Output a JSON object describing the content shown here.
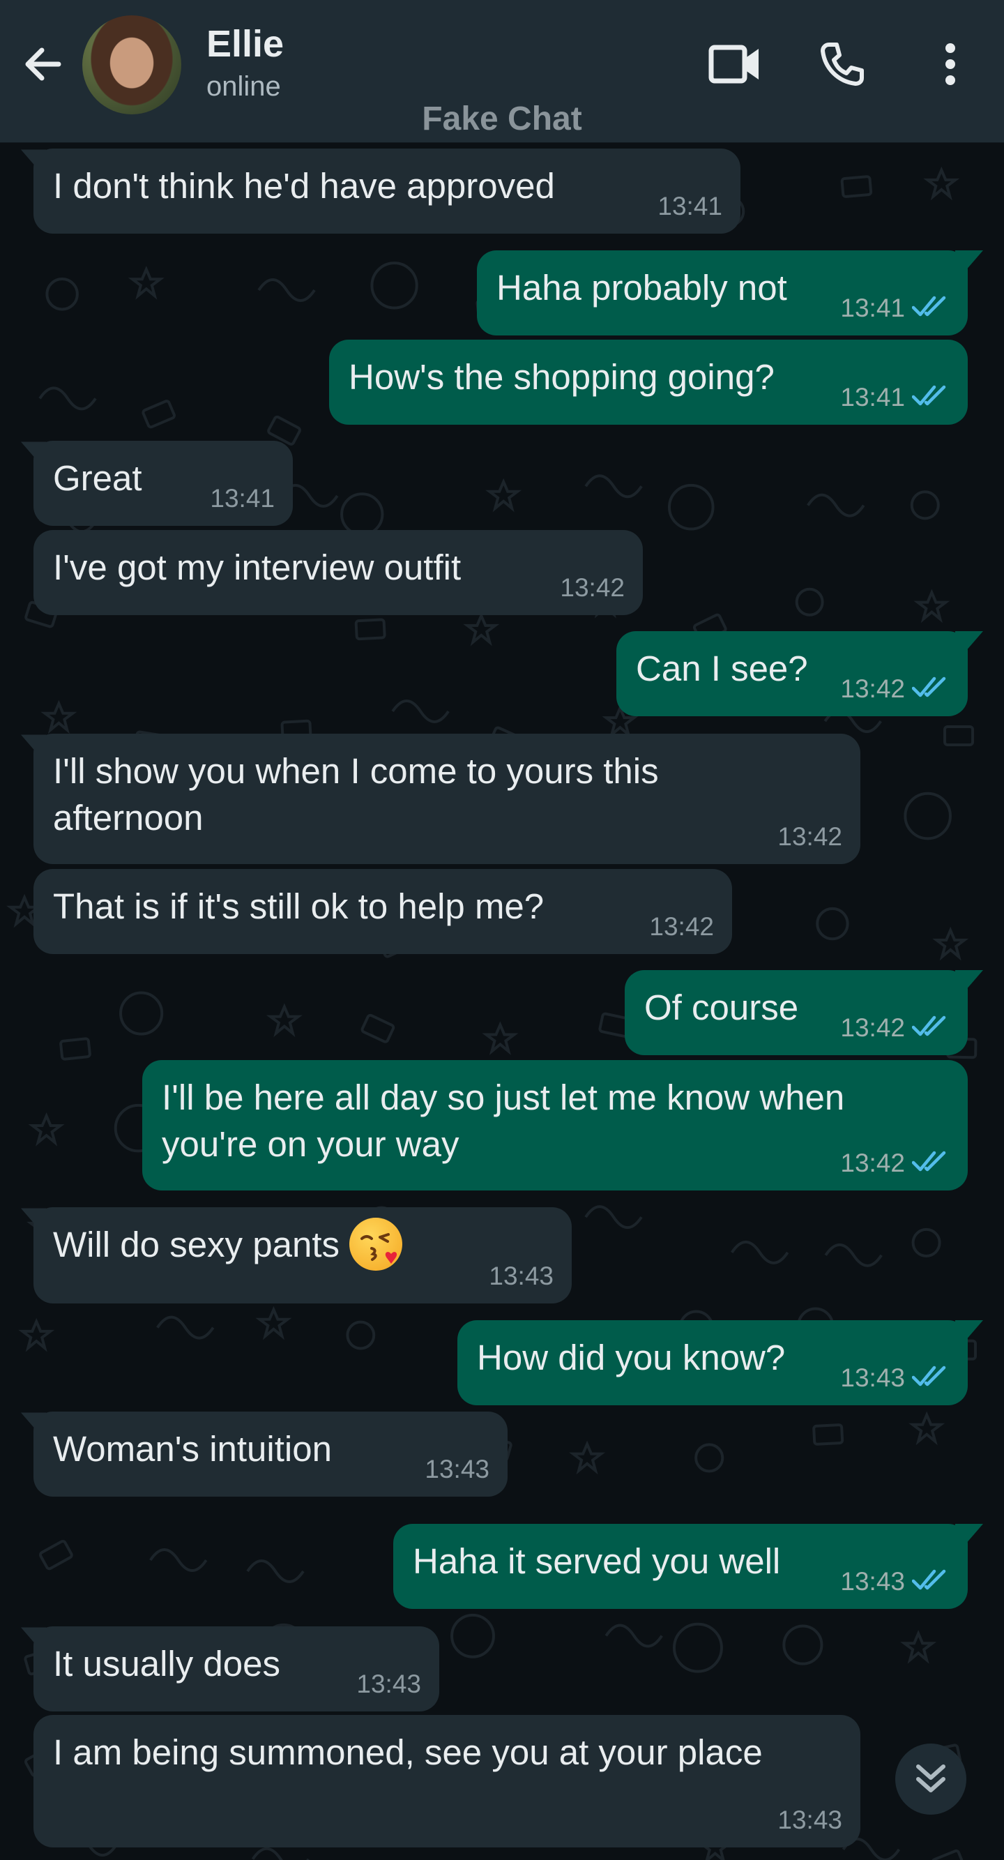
{
  "header": {
    "back_icon": "arrow-left-icon",
    "contact_name": "Ellie",
    "status": "online",
    "video_icon": "video-camera-icon",
    "call_icon": "phone-icon",
    "menu_icon": "more-vertical-icon"
  },
  "watermark": "Fake Chat",
  "colors": {
    "header_bg": "#1f2c34",
    "chat_bg": "#0b1014",
    "incoming_bubble": "#202c33",
    "outgoing_bubble": "#005c4b",
    "read_ticks": "#53bdeb"
  },
  "messages": [
    {
      "dir": "in",
      "text": "I don't think he'd have approved",
      "time": "13:41"
    },
    {
      "dir": "out",
      "text": "Haha probably not",
      "time": "13:41",
      "status": "read"
    },
    {
      "dir": "out",
      "text": "How's the shopping going?",
      "time": "13:41",
      "status": "read"
    },
    {
      "dir": "in",
      "text": "Great",
      "time": "13:41"
    },
    {
      "dir": "in",
      "text": "I've got my interview outfit",
      "time": "13:42"
    },
    {
      "dir": "out",
      "text": "Can I see?",
      "time": "13:42",
      "status": "read"
    },
    {
      "dir": "in",
      "text": "I'll show you when I come to yours this\nafternoon",
      "time": "13:42"
    },
    {
      "dir": "in",
      "text": "That is if it's still ok to help me?",
      "time": "13:42"
    },
    {
      "dir": "out",
      "text": "Of course",
      "time": "13:42",
      "status": "read"
    },
    {
      "dir": "out",
      "text": "I'll be here all day so just let me know when\nyou're on your way",
      "time": "13:42",
      "status": "read"
    },
    {
      "dir": "in",
      "text": "Will do sexy pants",
      "emoji": "face-blowing-a-kiss",
      "time": "13:43"
    },
    {
      "dir": "out",
      "text": "How did you know?",
      "time": "13:43",
      "status": "read"
    },
    {
      "dir": "in",
      "text": "Woman's intuition",
      "time": "13:43"
    },
    {
      "dir": "out",
      "text": "Haha it served you well",
      "time": "13:43",
      "status": "read"
    },
    {
      "dir": "in",
      "text": "It usually does",
      "time": "13:43"
    },
    {
      "dir": "in",
      "text": "I am being summoned, see you at your place",
      "time": "13:43"
    }
  ],
  "scroll_button_icon": "double-chevron-down-icon"
}
